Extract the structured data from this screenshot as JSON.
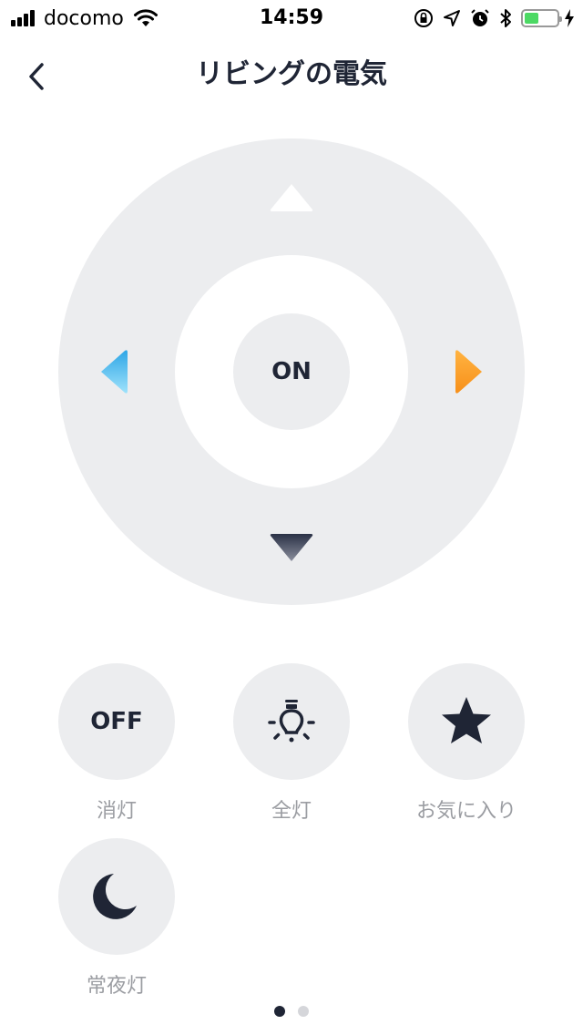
{
  "status_bar": {
    "carrier": "docomo",
    "time": "14:59",
    "battery_level": 0.45
  },
  "header": {
    "title": "リビングの電気"
  },
  "remote": {
    "center_label": "ON"
  },
  "buttons": [
    {
      "face": "OFF",
      "label": "消灯",
      "icon": "off-text"
    },
    {
      "label": "全灯",
      "icon": "light-bulb-icon"
    },
    {
      "label": "お気に入り",
      "icon": "star-icon"
    },
    {
      "label": "常夜灯",
      "icon": "moon-icon"
    }
  ],
  "pager": {
    "pages": 2,
    "current": 1
  },
  "colors": {
    "left_arrow": "#5ac8fa",
    "right_arrow": "#ff9500",
    "battery": "#4cd964",
    "surface": "#ecedef",
    "ink": "#1f2535"
  }
}
